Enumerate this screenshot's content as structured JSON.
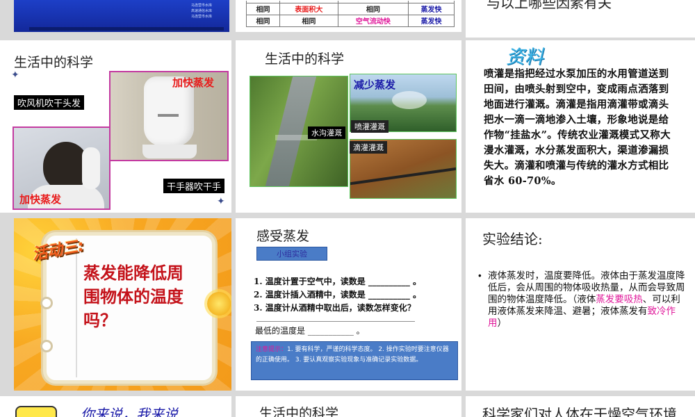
{
  "colors": {
    "accent_red": "#e81c1c",
    "accent_blue": "#1a1aa8",
    "accent_magenta": "#e0189a",
    "slide_navy": "#1836b4"
  },
  "slide1": {
    "tiny_lines": [
      "马连营市水库",
      "高速通信水库",
      "马连营市水库"
    ]
  },
  "slide2": {
    "rows": [
      [
        "相同",
        "表面积大",
        "相同",
        "蒸发快"
      ],
      [
        "相同",
        "相同",
        "空气流动快",
        "蒸发快"
      ]
    ]
  },
  "slide3": {
    "partial_text": "与以上哪些因素有关"
  },
  "slide4": {
    "title": "生活中的科学",
    "hairdryer_caption": "吹风机吹干头发",
    "handdryer_caption": "干手器吹干手",
    "faster_top": "加快蒸发",
    "faster_bottom": "加快蒸发",
    "icon_star": "sparkle-icon"
  },
  "slide5": {
    "title": "生活中的科学",
    "ditch_label": "水沟灌溉",
    "reduce_label": "减少蒸发",
    "spray_label": "喷灌灌溉",
    "drip_label": "滴灌灌溉"
  },
  "slide6": {
    "heading": "资料",
    "paragraph": "喷灌是指把经过水泵加压的水用管道送到田间，由喷头射到空中，变成雨点洒落到地面进行灌溉。滴灌是指用滴灌带或滴头把水一滴一滴地渗入土壤，形象地说是给作物“挂盐水”。传统农业灌溉模式又称大漫水灌溉，水分蒸发面积大，渠道渗漏损失大。滴灌和喷灌与传统的灌水方式相比省水 60-70%。"
  },
  "slide7": {
    "badge": "活动三:",
    "question": "蒸发能降低周围物体的温度吗？"
  },
  "slide8": {
    "title": "感受蒸发",
    "group_tag": "小组实验",
    "q1": "1. 温度计置于空气中，读数是 __________ 。",
    "q2": "2. 温度计插入酒精中，读数是 __________ 。",
    "q3": "3. 温度计从酒精中取出后，读数怎样变化？",
    "answer_line": "______________________________________",
    "lowest": "最低的温度是 ___________ 。",
    "note_label": "注意提示：",
    "note_text": "1. 要有科学，严谨的科学态度。 2. 操作实验时要注意仪器的正确使用。 3. 要认真观察实验现象与准确记录实验数据。"
  },
  "slide9": {
    "title": "实验结论:",
    "bullet_a": "液体蒸发时，温度要降低。液体由于蒸发温度降低后，会从周围的物体吸收热量，从而会导致周围的物体温度降低。（液体",
    "bullet_hl1": "蒸发要吸热",
    "bullet_b": "、可以利用液体蒸发来降温、避暑；液体蒸发有",
    "bullet_hl2": "致冷作用",
    "bullet_c": "）"
  },
  "slide10": {
    "partial_text": "你来说，我来说"
  },
  "slide11": {
    "title": "生活中的科学"
  },
  "slide12": {
    "partial_text": "科学家们对人体在干燥空气环境"
  }
}
